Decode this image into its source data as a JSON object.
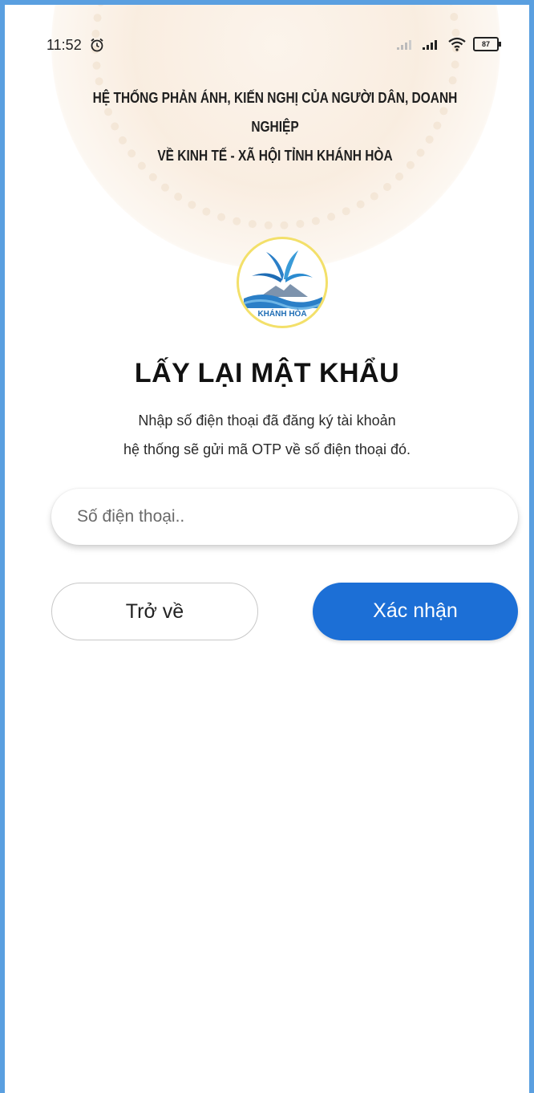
{
  "status_bar": {
    "time": "11:52",
    "battery": "87",
    "icons": [
      "alarm-icon",
      "signal-icon",
      "wifi-icon",
      "battery-icon"
    ]
  },
  "header": {
    "line1": "HỆ THỐNG PHẢN ÁNH, KIẾN NGHỊ CỦA NGƯỜI DÂN, DOANH NGHIỆP",
    "line2": "VỀ KINH TẾ - XÃ HỘI TỈNH KHÁNH HÒA"
  },
  "logo": {
    "text": "KHÁNH HÒA"
  },
  "page": {
    "title": "LẤY LẠI MẬT KHẨU",
    "subtitle_line1": "Nhập số điện thoại đã đăng ký tài khoản",
    "subtitle_line2": "hệ thống sẽ gửi mã OTP về số điện thoại đó."
  },
  "form": {
    "phone_value": "",
    "phone_placeholder": "Số điện thoại.."
  },
  "buttons": {
    "back_label": "Trở về",
    "confirm_label": "Xác nhận"
  },
  "colors": {
    "accent": "#1c6fd6",
    "frame": "#5a9fe0"
  }
}
